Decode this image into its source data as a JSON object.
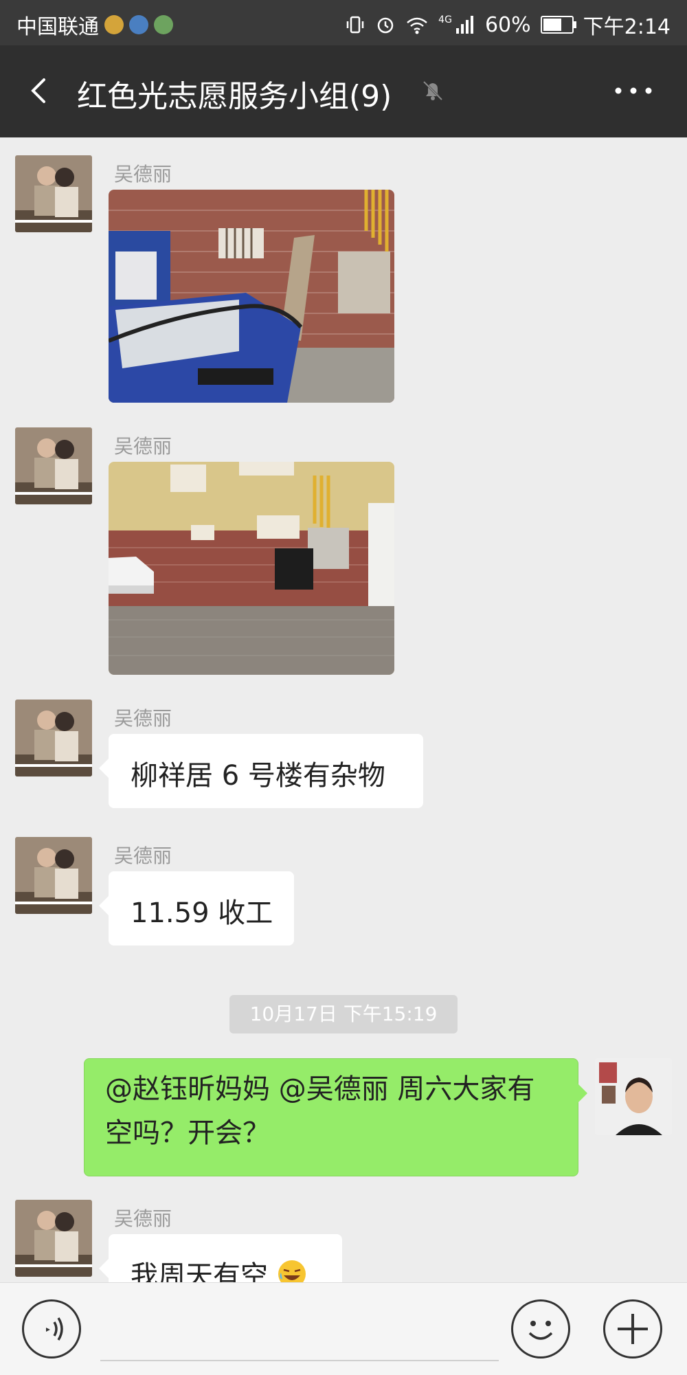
{
  "status_bar": {
    "carrier": "中国联通",
    "network": "4G",
    "battery": "60%",
    "time": "下午2:14"
  },
  "header": {
    "title": "红色光志愿服务小组(9)"
  },
  "messages": {
    "m1": {
      "sender": "吴德丽"
    },
    "m2": {
      "sender": "吴德丽"
    },
    "m3": {
      "sender": "吴德丽",
      "text": "柳祥居 6 号楼有杂物"
    },
    "m4": {
      "sender": "吴德丽",
      "text": "11.59 收工"
    },
    "timestamp": "10月17日 下午15:19",
    "m5": {
      "text": "@赵钰昕妈妈 @吴德丽 周六大家有空吗？开会？"
    },
    "m6": {
      "sender": "吴德丽",
      "text": "我周天有空"
    }
  },
  "colors": {
    "header_bg": "#2f2f2f",
    "chat_bg": "#ededed",
    "outgoing_bubble": "#95ec69"
  }
}
